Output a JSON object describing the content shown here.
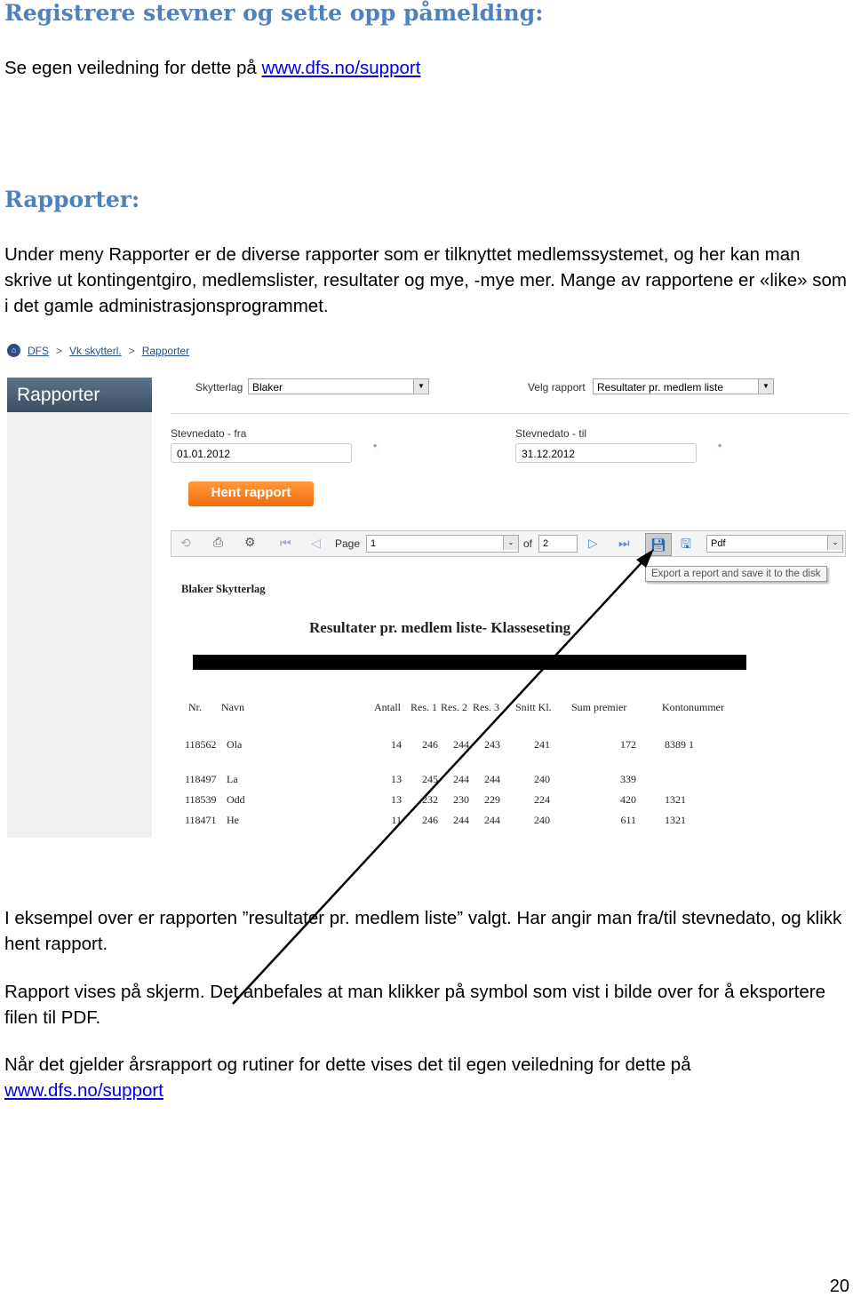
{
  "heading1": "Registrere stevner og sette opp påmelding:",
  "intro_text": "Se egen veiledning for dette på ",
  "intro_link": "www.dfs.no/support",
  "heading2": "Rapporter:",
  "para1": "Under meny Rapporter er de diverse rapporter som er tilknyttet medlemssystemet, og her kan man skrive ut kontingentgiro, medlemslister, resultater og mye, -mye mer. Mange av rapportene er «like» som i det gamle administrasjonsprogrammet.",
  "screenshot": {
    "breadcrumb": [
      "DFS",
      "Vk skytterl.",
      "Rapporter"
    ],
    "sidebar_title": "Rapporter",
    "skytterlag_label": "Skytterlag",
    "skytterlag_value": "Blaker",
    "velg_rapport_label": "Velg rapport",
    "velg_rapport_value": "Resultater pr. medlem liste",
    "fra_label": "Stevnedato - fra",
    "fra_value": "01.01.2012",
    "til_label": "Stevnedato - til",
    "til_value": "31.12.2012",
    "required_mark": "*",
    "hent_button": "Hent rapport",
    "toolbar": {
      "page_label": "Page",
      "page_value": "1",
      "of_label": "of",
      "of_value": "2",
      "format_value": "Pdf",
      "tooltip": "Export a report and save it to the disk"
    },
    "report": {
      "club": "Blaker Skytterlag",
      "title": "Resultater pr. medlem liste- Klasseseting",
      "columns": [
        "Nr.",
        "Navn",
        "Antall",
        "Res. 1",
        "Res. 2",
        "Res. 3",
        "Snitt Kl.",
        "Sum premier",
        "Kontonummer"
      ],
      "rows": [
        [
          "118562",
          "Ola",
          "14",
          "246",
          "244",
          "243",
          "241",
          "172",
          "8389 1"
        ],
        [
          "118497",
          "La",
          "13",
          "245",
          "244",
          "244",
          "240",
          "339",
          ""
        ],
        [
          "118539",
          "Odd",
          "13",
          "232",
          "230",
          "229",
          "224",
          "420",
          "1321"
        ],
        [
          "118471",
          "He",
          "11",
          "246",
          "244",
          "244",
          "240",
          "611",
          "1321"
        ]
      ]
    }
  },
  "para2": "I eksempel over er rapporten ”resultater pr. medlem liste” valgt. Har angir man fra/til stevnedato, og klikk hent rapport.",
  "para3": "Rapport vises på skjerm. Det anbefales at man klikker på symbol som vist i bilde over for å eksportere filen til PDF.",
  "para4": "Når det gjelder årsrapport og rutiner for dette vises det til egen veiledning for dette på ",
  "para4_link": "www.dfs.no/support",
  "page_number": "20"
}
